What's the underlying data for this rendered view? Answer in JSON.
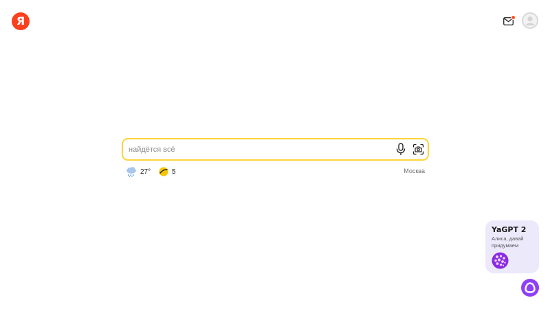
{
  "header": {
    "logo_letter": "Я",
    "mail_has_unread": true
  },
  "search": {
    "placeholder": "найдётся всё",
    "value": "",
    "border_color": "#fcd53a"
  },
  "info": {
    "weather_temp": "27°",
    "traffic_level": "5",
    "city": "Москва"
  },
  "promo": {
    "title": "YaGPT 2",
    "subtitle": "Алиса, давай придумаем"
  },
  "colors": {
    "brand_red": "#fc3f1d",
    "alice_purple": "#8f3ff5",
    "promo_bg": "#ece9fb",
    "traffic_yellow": "#f7c500"
  },
  "icons": {
    "logo": "yandex-logo",
    "mail": "mail-icon",
    "avatar": "user-avatar",
    "mic": "microphone-icon",
    "lens": "camera-search-icon",
    "weather": "rain-cloud-icon",
    "traffic": "traffic-light-icon",
    "alice": "alice-icon"
  }
}
